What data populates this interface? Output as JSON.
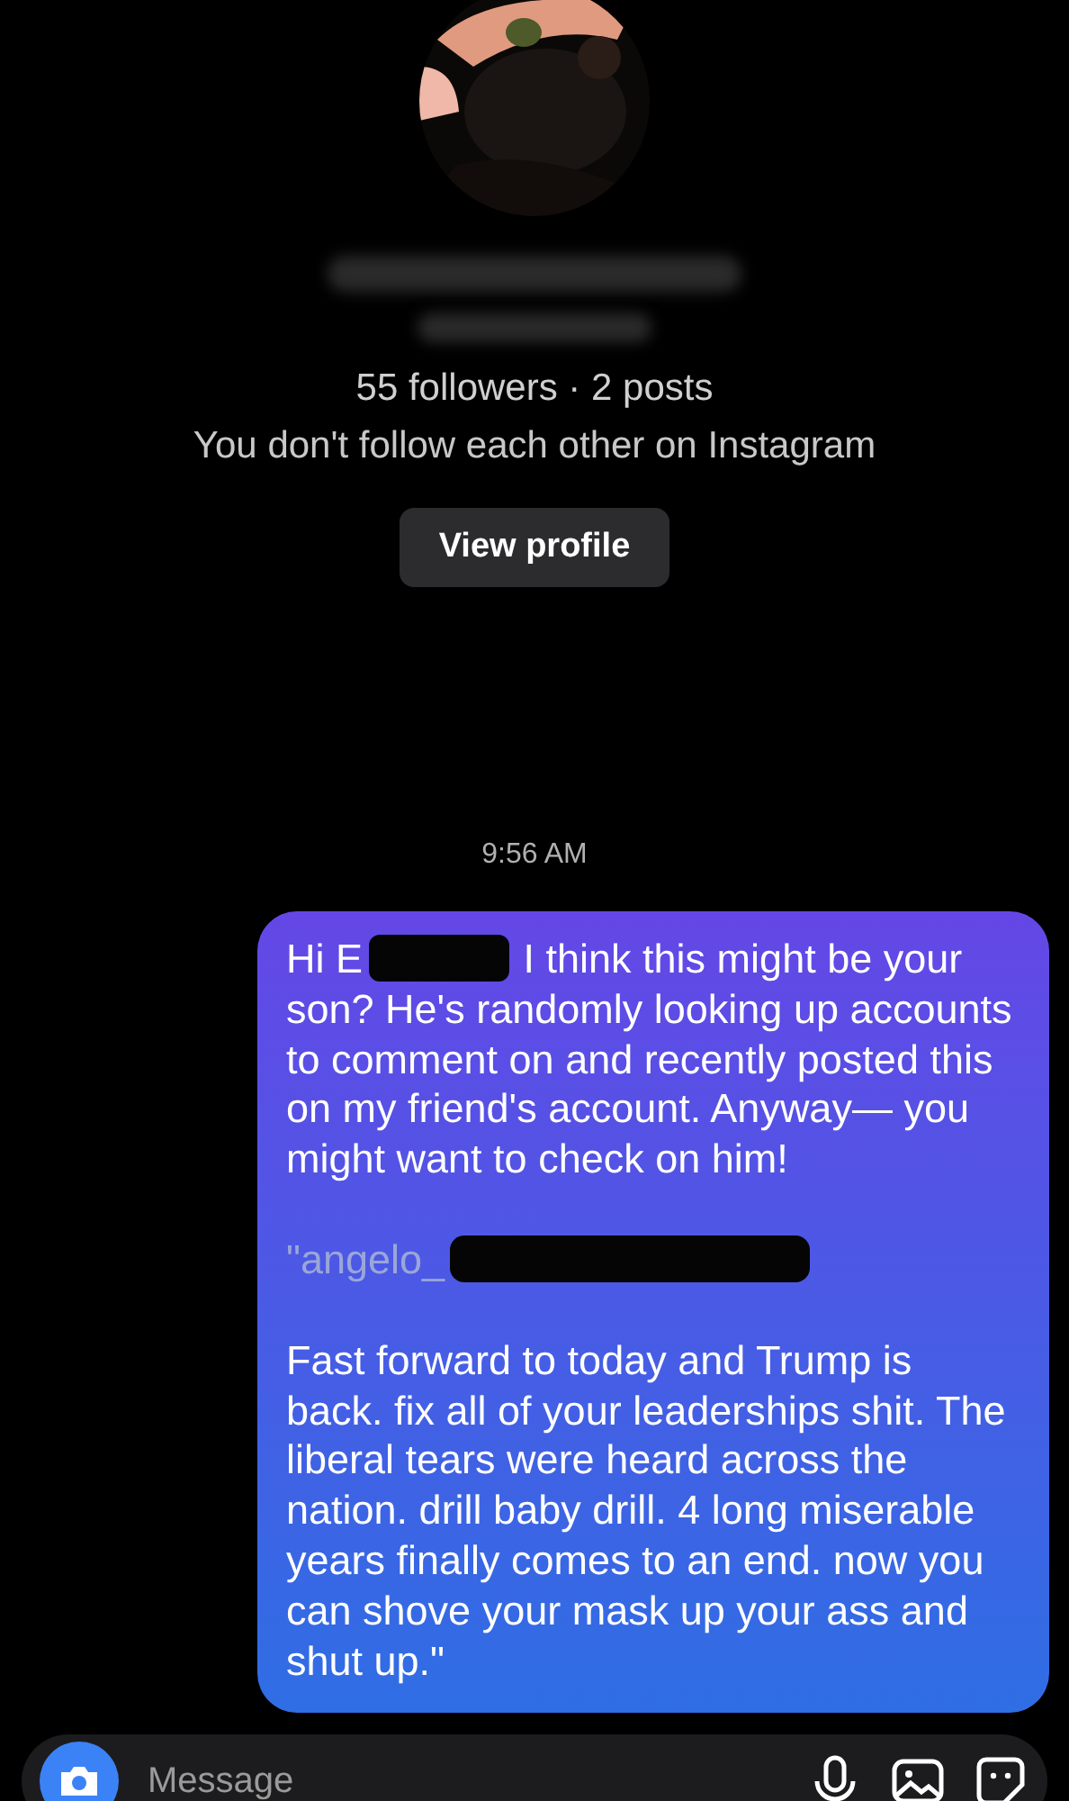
{
  "profile": {
    "stats": "55 followers · 2 posts",
    "relationship": "You don't follow each other on Instagram",
    "button": "View profile"
  },
  "timestamp": "9:56 AM",
  "messages": [
    {
      "kind": "sent",
      "paragraphs": [
        {
          "kind": "redacted",
          "before": "Hi E",
          "after": "I think this might be your son? He's randomly looking up accounts to comment on and recently posted this on my friend's account. Anyway— you might want to check on him!"
        },
        {
          "kind": "author",
          "text": "\"angelo_"
        },
        {
          "kind": "text",
          "text": "Fast forward to today and Trump is back. fix all of your leaderships shit. The liberal tears were heard across the nation. drill baby drill. 4 long miserable years finally comes to an end. now you can shove your mask up your ass and shut up.\""
        }
      ]
    }
  ],
  "composer": {
    "placeholder": "Message"
  }
}
